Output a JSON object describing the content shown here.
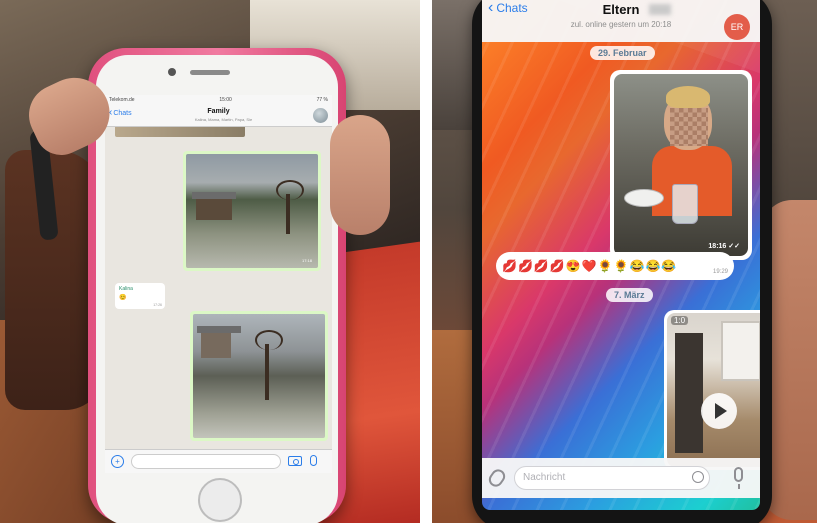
{
  "left_phone": {
    "status": {
      "carrier": "Telekom.de",
      "time": "15:00",
      "battery": "77 %"
    },
    "header": {
      "back_label": "Chats",
      "title": "Family",
      "members": "Kalina, Mama, Martin, Papa, Sie"
    },
    "messages": [
      {
        "type": "image",
        "time": "17:18"
      },
      {
        "type": "text",
        "sender": "Kalina",
        "emoji": "😊",
        "time": "17:26"
      },
      {
        "type": "image",
        "time": ""
      }
    ]
  },
  "right_phone": {
    "header": {
      "back_label": "Chats",
      "title": "Eltern",
      "subtitle": "zul. online gestern um 20:18",
      "avatar_initials": "ER"
    },
    "date_1": "29. Februar",
    "photo_time": "18:16 ✓✓",
    "emoji_message": "💋💋💋💋😍❤️🌻🌻😂😂😂",
    "emoji_time": "19:29",
    "date_2": "7. März",
    "video_duration": "1:0",
    "input_placeholder": "Nachricht"
  },
  "colors": {
    "whatsapp_bubble": "#dcf8c6",
    "ios_blue": "#2b7de9",
    "avatar_red": "#e35d4a",
    "phone_pink": "#f07aa0"
  }
}
